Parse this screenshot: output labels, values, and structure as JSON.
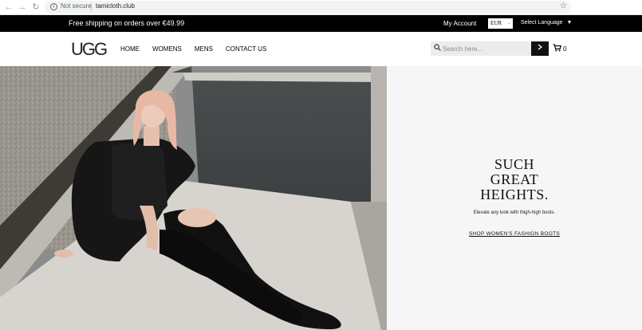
{
  "browser": {
    "security_label": "Not secure",
    "url": "tamicloth.club"
  },
  "topbar": {
    "promo": "Free shipping on orders over €49.99",
    "account": "My Account",
    "currency": "EUR",
    "language": "Select Language"
  },
  "header": {
    "logo": "UGG",
    "nav": [
      "HOME",
      "WOMENS",
      "MENS",
      "CONTACT US"
    ],
    "search_placeholder": "Search here...",
    "cart_count": "0"
  },
  "hero": {
    "headline": [
      "SUCH",
      "GREAT",
      "HEIGHTS."
    ],
    "subcopy": "Elevate any look with thigh-high boots.",
    "cta": "SHOP WOMEN'S FASHION BOOTS"
  },
  "icons": {
    "back": "back-arrow-icon",
    "forward": "forward-arrow-icon",
    "reload": "reload-icon",
    "info": "info-icon",
    "star": "bookmark-star-icon",
    "search": "search-icon",
    "submit": "arrow-right-icon",
    "cart": "cart-icon"
  },
  "colors": {
    "topbar": "#000000",
    "hero_panel": "#f6f6f6",
    "search_button": "#111111"
  }
}
